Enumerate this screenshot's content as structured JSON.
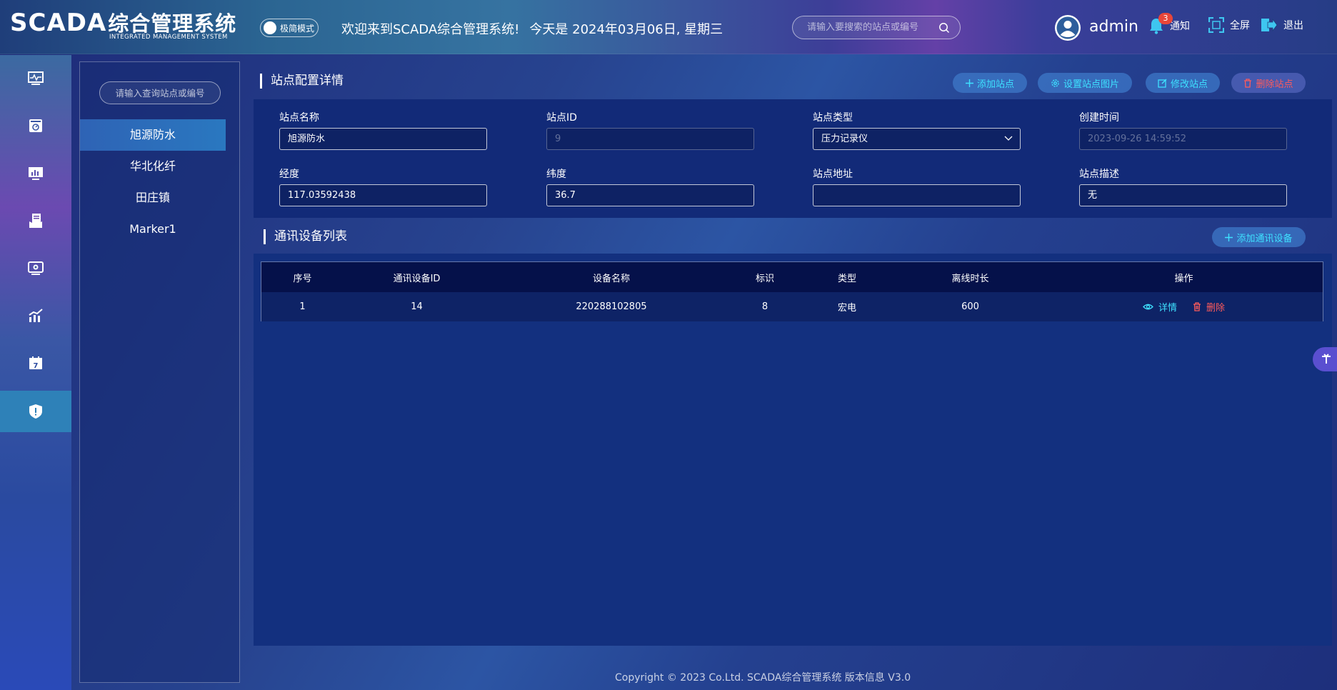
{
  "header": {
    "logo_main": "SCADA",
    "logo_cn": "综合管理系统",
    "logo_sub": "INTEGRATED MANAGEMENT SYSTEM",
    "toggle_label": "极简模式",
    "welcome": "欢迎来到SCADA综合管理系统!",
    "date": "今天是 2024年03月06日, 星期三",
    "search_placeholder": "请输入要搜索的站点或编号",
    "username": "admin",
    "notify_count": "3",
    "notify_label": "通知",
    "fullscreen_label": "全屏",
    "logout_label": "退出"
  },
  "rail": {
    "items": [
      "monitor-icon",
      "dashboard-icon",
      "screen-chart-icon",
      "report-icon",
      "video-icon",
      "trend-icon",
      "calendar-icon",
      "shield-icon"
    ],
    "active_index": 7,
    "calendar_day": "7"
  },
  "sites": {
    "search_placeholder": "请输入查询站点或编号",
    "items": [
      "旭源防水",
      "华北化纤",
      "田庄镇",
      "Marker1"
    ],
    "active_index": 0
  },
  "config": {
    "title": "站点配置详情",
    "buttons": {
      "add": "添加站点",
      "set_image": "设置站点图片",
      "edit": "修改站点",
      "delete": "删除站点"
    },
    "fields": {
      "name_label": "站点名称",
      "name_value": "旭源防水",
      "id_label": "站点ID",
      "id_value": "9",
      "type_label": "站点类型",
      "type_value": "压力记录仪",
      "created_label": "创建时间",
      "created_value": "2023-09-26 14:59:52",
      "lng_label": "经度",
      "lng_value": "117.03592438",
      "lat_label": "纬度",
      "lat_value": "36.7",
      "addr_label": "站点地址",
      "addr_value": "",
      "desc_label": "站点描述",
      "desc_value": "无"
    }
  },
  "devices": {
    "title": "通讯设备列表",
    "add_button": "添加通讯设备",
    "columns": [
      "序号",
      "通讯设备ID",
      "设备名称",
      "标识",
      "类型",
      "离线时长",
      "操作"
    ],
    "rows": [
      {
        "index": "1",
        "device_id": "14",
        "name": "220288102805",
        "tag": "8",
        "type": "宏电",
        "offline": "600",
        "detail": "详情",
        "delete": "删除"
      }
    ]
  },
  "footer": "Copyright © 2023 Co.Ltd. SCADA综合管理系统 版本信息 V3.0",
  "colors": {
    "accent": "#3ee1ff",
    "danger": "#ff5b5b",
    "active_rail": "#2e81b8"
  }
}
